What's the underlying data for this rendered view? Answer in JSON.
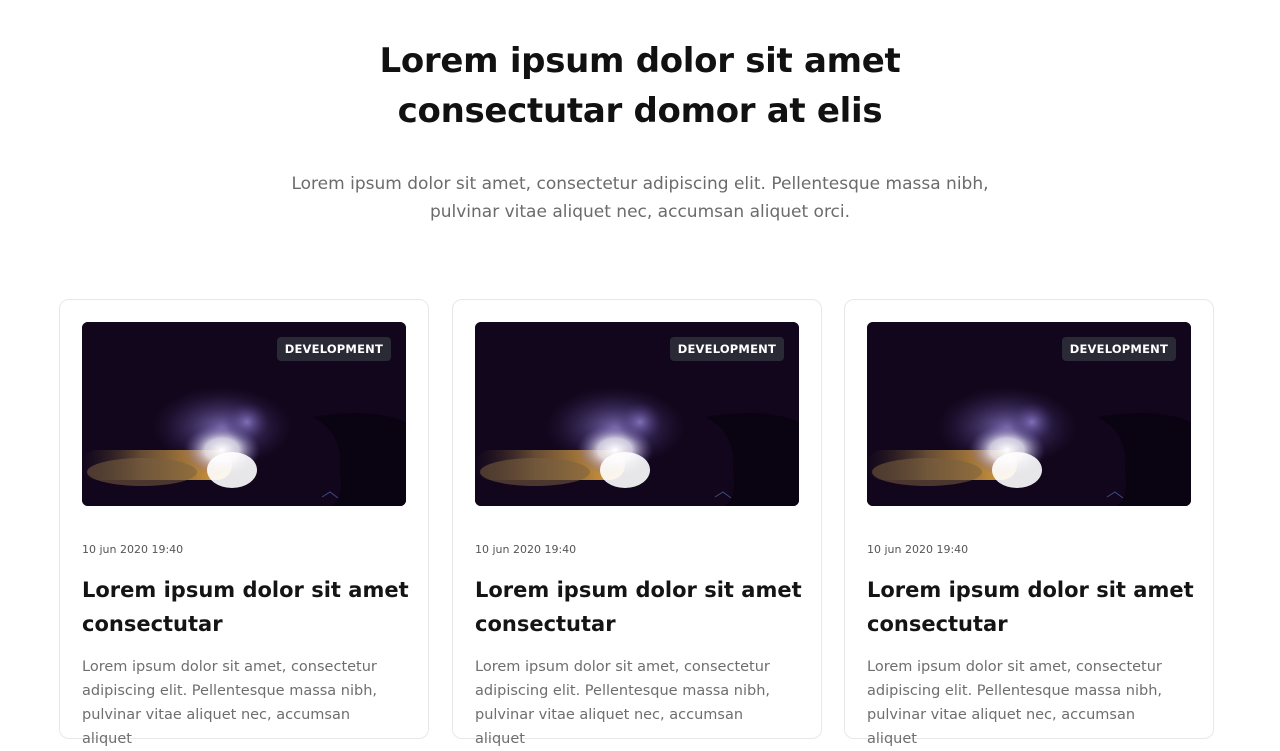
{
  "hero": {
    "title": "Lorem ipsum dolor sit amet consectutar domor at elis",
    "subtitle": "Lorem ipsum dolor sit amet, consectetur adipiscing elit. Pellentesque massa nibh, pulvinar vitae aliquet nec, accumsan aliquet orci."
  },
  "cards": [
    {
      "badge": "DEVELOPMENT",
      "date": "10 jun 2020 19:40",
      "title": "Lorem ipsum dolor sit amet consectutar",
      "excerpt": "Lorem ipsum dolor sit amet, consectetur adipiscing elit. Pellentesque massa nibh, pulvinar vitae aliquet nec, accumsan aliquet"
    },
    {
      "badge": "DEVELOPMENT",
      "date": "10 jun 2020 19:40",
      "title": "Lorem ipsum dolor sit amet consectutar",
      "excerpt": "Lorem ipsum dolor sit amet, consectetur adipiscing elit. Pellentesque massa nibh, pulvinar vitae aliquet nec, accumsan aliquet"
    },
    {
      "badge": "DEVELOPMENT",
      "date": "10 jun 2020 19:40",
      "title": "Lorem ipsum dolor sit amet consectutar",
      "excerpt": "Lorem ipsum dolor sit amet, consectetur adipiscing elit. Pellentesque massa nibh, pulvinar vitae aliquet nec, accumsan aliquet"
    }
  ],
  "colors": {
    "badge_bg": "#2a2936",
    "image_bg": "#12061c",
    "muted_text": "#6b6b6b",
    "card_border": "#e8e8e8"
  }
}
